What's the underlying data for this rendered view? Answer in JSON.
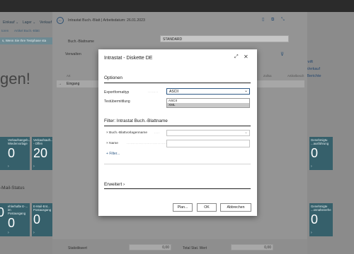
{
  "background": {
    "nav": [
      "Einkauf ⌄",
      "Lager ⌄",
      "Verkauf ⌄"
    ],
    "sub": [
      "toren",
      "Artikel Buch.-Blätt"
    ],
    "banner": "s, Wenn Sie Ihre Testphase sta",
    "greeting": "gen!",
    "right_links": [
      "‹ Verkauf",
      "› Berichte"
    ],
    "right_link_top": "chrift",
    "tiles_row1": [
      {
        "label": "",
        "value": ""
      },
      {
        "label": "Verkaufsangeb...\nWiedervorlage",
        "value": "0"
      },
      {
        "label": "Verkaufsauft...\n- Offen",
        "value": "20"
      }
    ],
    "tiles_right": {
      "label": "Genehmigtu\n...ausführung",
      "value": "0"
    },
    "mail_status_title": "-Mail-Status",
    "tiles_row2": [
      {
        "label": "",
        "value": "0"
      },
      {
        "label": "ehlerhafte E-...\nim Postausgang",
        "value": "0"
      },
      {
        "label": "E-Mail-Ent...\nPostausgang",
        "value": "0"
      }
    ],
    "tiles_row2_right": [
      {
        "label": "",
        "value": "0"
      },
      {
        "label": "Genehmigte\n...onnaheverhe",
        "value": "0"
      }
    ]
  },
  "page": {
    "title": "Intrastat Buch.-Blatt | Arbeitsdatum: 26.01.2023",
    "journal_label": "Buch.-Blattname",
    "journal_value": "STANDARD",
    "action_manage": "Verwalten",
    "grid_headers": [
      "Art",
      "Zollsa",
      "Artikelbesch"
    ],
    "grid_row": "Eingang",
    "footer_labels": [
      "Statistikwert",
      "Total Stat. Wert"
    ],
    "footer_values": [
      "0,00",
      "0,00"
    ]
  },
  "dialog": {
    "title": "Intrastat - Diskette DE",
    "sections": {
      "options": "Optionen",
      "filter": "Filter: Intrastat Buch.-Blattname",
      "advanced": "Erweitert"
    },
    "fields": {
      "export_format_label": "Exportformattyp",
      "export_format_value": "ASCII",
      "test_label": "Testübermittlung",
      "filter1_label": "Buch.-Blattvorlagenname",
      "filter2_label": "Name",
      "add_filter": "Filter..."
    },
    "dropdown_options": [
      "ASCII",
      "XML"
    ],
    "buttons": {
      "plan": "Plan...",
      "ok": "OK",
      "cancel": "Abbrechen"
    }
  }
}
